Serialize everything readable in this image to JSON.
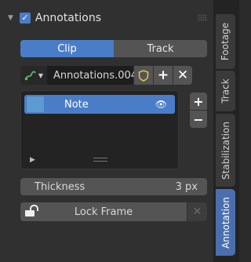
{
  "panel": {
    "title": "Annotations",
    "enabled_check": "✓",
    "collapse_icon": "triangle-down-icon"
  },
  "source_tabs": [
    {
      "label": "Clip",
      "active": true
    },
    {
      "label": "Track",
      "active": false
    }
  ],
  "datablock": {
    "browse_icon": "annotation-stroke-icon",
    "name": "Annotations.004",
    "fake_user_icon": "shield-icon",
    "new_label": "+",
    "unlink_label": "✕"
  },
  "layers": [
    {
      "name": "Note",
      "color": "#5c9bd2",
      "visible_icon": "eye-icon"
    }
  ],
  "list_controls": {
    "add": "+",
    "remove": "−"
  },
  "thickness": {
    "label": "Thickness",
    "value": "3 px"
  },
  "lock_frame": {
    "label": "Lock Frame",
    "clear": "✕"
  },
  "sidebar_tabs": [
    "Footage",
    "Track",
    "Stabilization",
    "Annotation"
  ],
  "active_sidebar_tab": "Annotation",
  "colors": {
    "accent": "#4a7dc8",
    "panel_bg": "#303030",
    "widget_bg": "#545454"
  }
}
